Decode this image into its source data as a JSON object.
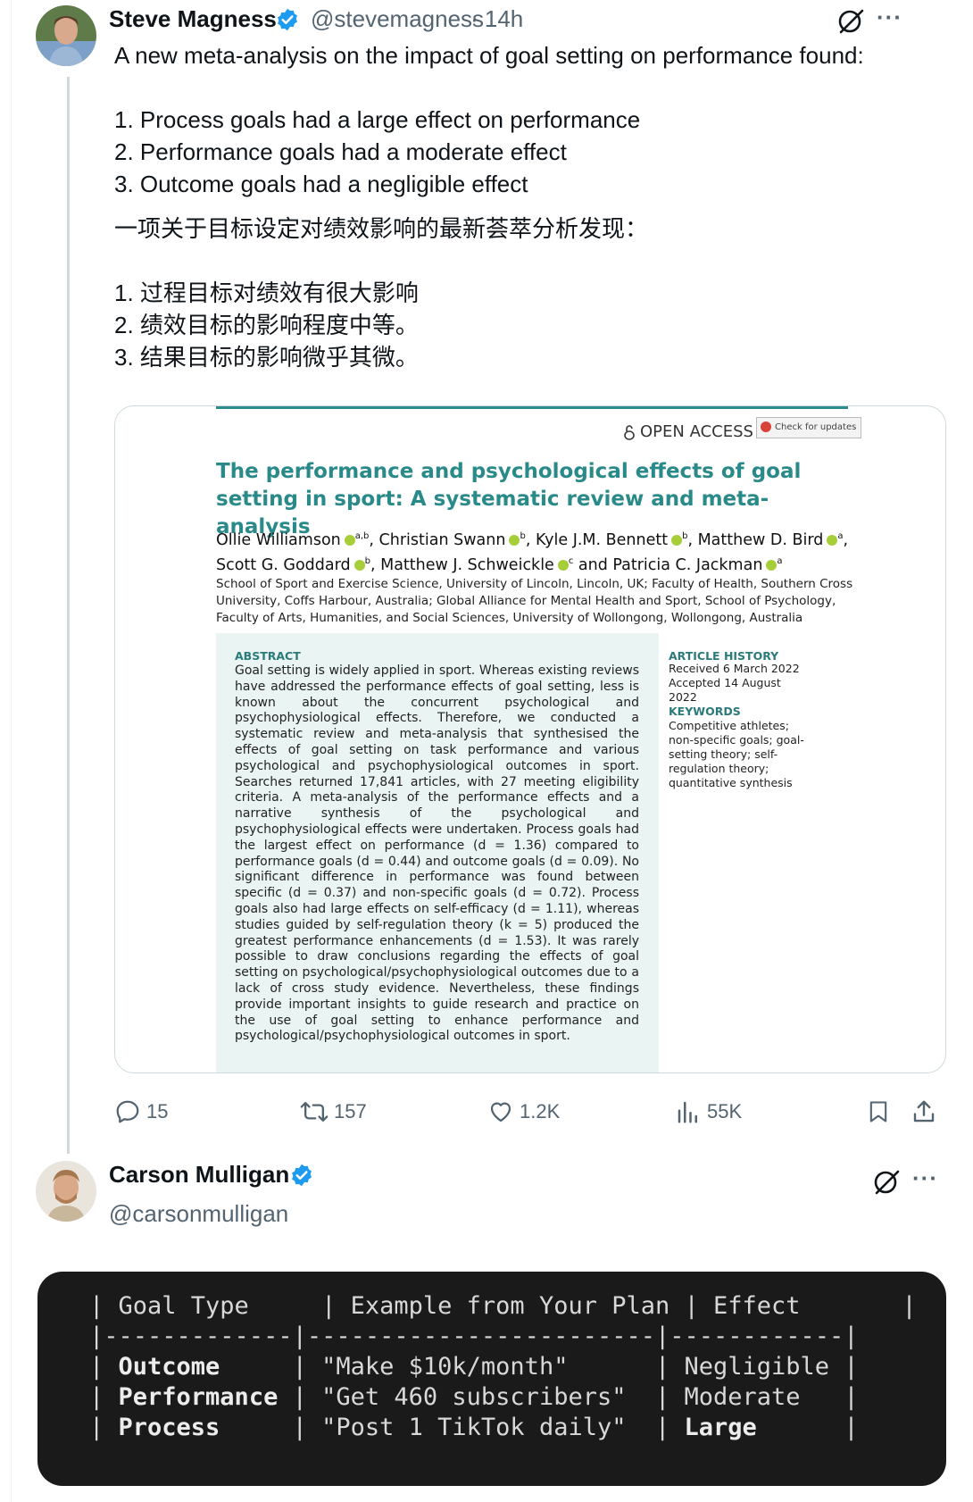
{
  "tweet1": {
    "name": "Steve Magness",
    "handle": "@stevemagness",
    "time": "· 14h",
    "lines": [
      "A new meta-analysis on the impact of goal setting on performance found:",
      "1. Process goals had a large effect on performance",
      "2. Performance goals had a moderate effect",
      "3. Outcome goals had a negligible effect",
      "一项关于目标设定对绩效影响的最新荟萃分析发现：",
      "1. 过程目标对绩效有很大影响",
      "2. 绩效目标的影响程度中等。",
      "3. 结果目标的影响微乎其微。"
    ],
    "stats": {
      "replies": "15",
      "retweets": "157",
      "likes": "1.2K",
      "views": "55K"
    }
  },
  "paper": {
    "open_access": "OPEN ACCESS",
    "check_updates": "Check for updates",
    "title": "The performance and psychological effects of goal setting in sport: A systematic review and meta-analysis",
    "authors_line1": "Ollie Williamson",
    "authors_line1_sup": "a,b",
    "author2": ", Christian Swann",
    "author2_sup": "b",
    "author3": ", Kyle J.M. Bennett",
    "author3_sup": "b",
    "author4": ", Matthew D. Bird",
    "author4_sup": "a",
    "author5": "Scott G. Goddard",
    "author5_sup": "b",
    "author6": ", Matthew J. Schweickle",
    "author6_sup": "c",
    "author7": " and Patricia C. Jackman",
    "author7_sup": "a",
    "affiliations": "School of Sport and Exercise Science, University of Lincoln, Lincoln, UK; Faculty of Health, Southern Cross University, Coffs Harbour, Australia; Global Alliance for Mental Health and Sport, School of Psychology, Faculty of Arts, Humanities, and Social Sciences, University of Wollongong, Wollongong, Australia",
    "abstract_heading": "ABSTRACT",
    "abstract": "Goal setting is widely applied in sport. Whereas existing reviews have addressed the performance effects of goal setting, less is known about the concurrent psychological and psychophysiological effects. Therefore, we conducted a systematic review and meta-analysis that synthesised the effects of goal setting on task performance and various psychological and psychophysiological outcomes in sport. Searches returned 17,841 articles, with 27 meeting eligibility criteria. A meta-analysis of the performance effects and a narrative synthesis of the psychological and psychophysiological effects were undertaken. Process goals had the largest effect on performance (d = 1.36) compared to performance goals (d = 0.44) and outcome goals (d = 0.09). No significant difference in performance was found between specific (d = 0.37) and non-specific goals (d = 0.72). Process goals also had large effects on self-efficacy (d = 1.11), whereas studies guided by self-regulation theory (k = 5) produced the greatest performance enhancements (d = 1.53). It was rarely possible to draw conclusions regarding the effects of goal setting on psychological/psychophysiological outcomes due to a lack of cross study evidence. Nevertheless, these findings provide important insights to guide research and practice on the use of goal setting to enhance performance and psychological/psychophysiological outcomes in sport.",
    "history_heading": "ARTICLE HISTORY",
    "received": "Received 6 March 2022",
    "accepted": "Accepted 14 August 2022",
    "keywords_heading": "KEYWORDS",
    "keywords": "Competitive athletes; non-specific goals; goal-setting theory; self-regulation theory; quantitative synthesis"
  },
  "tweet2": {
    "name": "Carson Mulligan",
    "handle": "@carsonmulligan",
    "table": {
      "headers": [
        "Goal Type",
        "Example from Your Plan",
        "Effect"
      ],
      "rows": [
        [
          "Outcome",
          "\"Make $10k/month\"",
          "Negligible"
        ],
        [
          "Performance",
          "\"Get 460 subscribers\"",
          "Moderate"
        ],
        [
          "Process",
          "\"Post 1 TikTok daily\"",
          "Large"
        ]
      ]
    }
  },
  "colors": {
    "verified": "#1d9bf0",
    "paper_accent": "#2a8a8a",
    "abstract_bg": "#eaf4f2",
    "code_bg": "#1a1a1a"
  }
}
